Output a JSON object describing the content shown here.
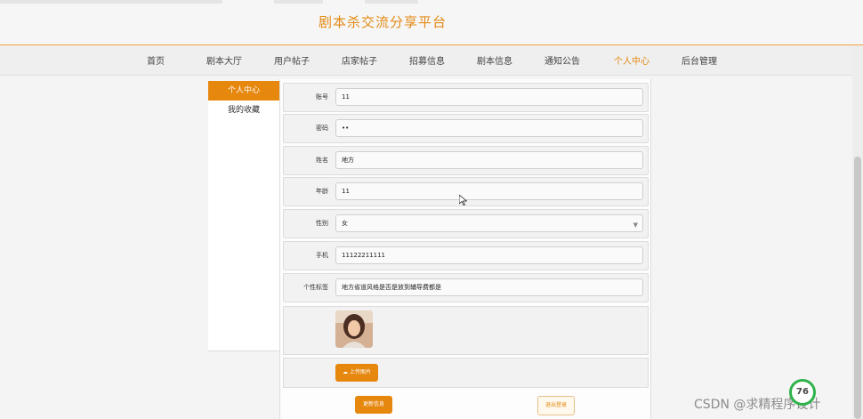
{
  "site": {
    "title": "剧本杀交流分享平台"
  },
  "nav": {
    "items": [
      "首页",
      "剧本大厅",
      "用户帖子",
      "店家帖子",
      "招募信息",
      "剧本信息",
      "通知公告",
      "个人中心",
      "后台管理"
    ],
    "active": "个人中心"
  },
  "sidebar": {
    "items": [
      {
        "label": "个人中心",
        "active": true
      },
      {
        "label": "我的收藏",
        "active": false
      }
    ]
  },
  "form": {
    "fields": [
      {
        "label": "账号",
        "value": "11"
      },
      {
        "label": "密码",
        "value": "••"
      },
      {
        "label": "姓名",
        "value": "地方"
      },
      {
        "label": "年龄",
        "value": "11"
      },
      {
        "label": "性别",
        "value": "女"
      },
      {
        "label": "手机",
        "value": "11122211111"
      },
      {
        "label": "个性标签",
        "value": "地方省道风格是否是放到辅导费都是"
      }
    ],
    "upload_label": "上传图片",
    "update_label": "更新信息",
    "logout_label": "退出登录"
  },
  "overlay": {
    "watermark": "CSDN @求精程序设计",
    "timer": "76"
  },
  "colors": {
    "accent": "#e6870e",
    "title": "#e38a15"
  }
}
